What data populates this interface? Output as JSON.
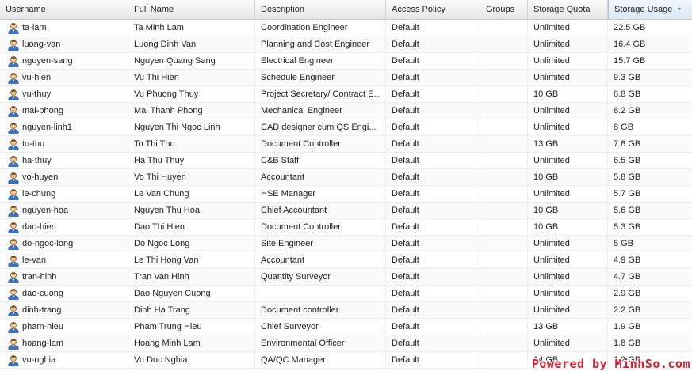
{
  "columns": {
    "username": "Username",
    "full_name": "Full Name",
    "description": "Description",
    "access_policy": "Access Policy",
    "groups": "Groups",
    "storage_quota": "Storage Quota",
    "storage_usage": "Storage Usage"
  },
  "sort": {
    "column": "storage_usage",
    "direction": "descending"
  },
  "rows": [
    {
      "username": "ta-lam",
      "full_name": "Ta Minh Lam",
      "description": "Coordination Engineer",
      "access_policy": "Default",
      "groups": "",
      "storage_quota": "Unlimited",
      "storage_usage": "22.5 GB"
    },
    {
      "username": "luong-van",
      "full_name": "Luong Dinh Van",
      "description": "Planning and Cost Engineer",
      "access_policy": "Default",
      "groups": "",
      "storage_quota": "Unlimited",
      "storage_usage": "16.4 GB"
    },
    {
      "username": "nguyen-sang",
      "full_name": "Nguyen Quang Sang",
      "description": "Electrical Engineer",
      "access_policy": "Default",
      "groups": "",
      "storage_quota": "Unlimited",
      "storage_usage": "15.7 GB"
    },
    {
      "username": "vu-hien",
      "full_name": "Vu Thi Hien",
      "description": "Schedule Engineer",
      "access_policy": "Default",
      "groups": "",
      "storage_quota": "Unlimited",
      "storage_usage": "9.3 GB"
    },
    {
      "username": "vu-thuy",
      "full_name": "Vu Phuong Thuy",
      "description": "Project Secretary/ Contract E...",
      "access_policy": "Default",
      "groups": "",
      "storage_quota": "10 GB",
      "storage_usage": "8.8 GB"
    },
    {
      "username": "mai-phong",
      "full_name": "Mai Thanh Phong",
      "description": "Mechanical Engineer",
      "access_policy": "Default",
      "groups": "",
      "storage_quota": "Unlimited",
      "storage_usage": "8.2 GB"
    },
    {
      "username": "nguyen-linh1",
      "full_name": "Nguyen Thi Ngoc Linh",
      "description": " CAD designer cum QS Engi...",
      "access_policy": "Default",
      "groups": "",
      "storage_quota": "Unlimited",
      "storage_usage": "8 GB"
    },
    {
      "username": "to-thu",
      "full_name": "To Thi Thu",
      "description": "Document Controller",
      "access_policy": "Default",
      "groups": "",
      "storage_quota": "13 GB",
      "storage_usage": "7.8 GB"
    },
    {
      "username": "ha-thuy",
      "full_name": "Ha Thu Thuy",
      "description": "C&B Staff",
      "access_policy": "Default",
      "groups": "",
      "storage_quota": "Unlimited",
      "storage_usage": "6.5 GB"
    },
    {
      "username": "vo-huyen",
      "full_name": "Vo Thi Huyen",
      "description": "Accountant",
      "access_policy": "Default",
      "groups": "",
      "storage_quota": "10 GB",
      "storage_usage": "5.8 GB"
    },
    {
      "username": "le-chung",
      "full_name": "Le Van Chung",
      "description": "HSE Manager",
      "access_policy": "Default",
      "groups": "",
      "storage_quota": "Unlimited",
      "storage_usage": "5.7 GB"
    },
    {
      "username": "nguyen-hoa",
      "full_name": "Nguyen Thu Hoa",
      "description": "Chief Accountant",
      "access_policy": "Default",
      "groups": "",
      "storage_quota": "10 GB",
      "storage_usage": "5.6 GB"
    },
    {
      "username": "dao-hien",
      "full_name": "Dao Thi Hien",
      "description": "Document Controller",
      "access_policy": "Default",
      "groups": "",
      "storage_quota": "10 GB",
      "storage_usage": "5.3 GB"
    },
    {
      "username": "do-ngoc-long",
      "full_name": "Do Ngoc Long",
      "description": "Site Engineer",
      "access_policy": "Default",
      "groups": "",
      "storage_quota": "Unlimited",
      "storage_usage": "5 GB"
    },
    {
      "username": "le-van",
      "full_name": "Le Thi Hong Van",
      "description": "Accountant",
      "access_policy": "Default",
      "groups": "",
      "storage_quota": "Unlimited",
      "storage_usage": "4.9 GB"
    },
    {
      "username": "tran-hinh",
      "full_name": "Tran Van Hinh",
      "description": "Quantity Surveyor",
      "access_policy": "Default",
      "groups": "",
      "storage_quota": "Unlimited",
      "storage_usage": "4.7 GB"
    },
    {
      "username": "dao-cuong",
      "full_name": "Dao Nguyen Cuong",
      "description": "",
      "access_policy": "Default",
      "groups": "",
      "storage_quota": "Unlimited",
      "storage_usage": "2.9 GB"
    },
    {
      "username": "dinh-trang",
      "full_name": "Dinh Ha Trang",
      "description": "Document controller",
      "access_policy": "Default",
      "groups": "",
      "storage_quota": "Unlimited",
      "storage_usage": "2.2 GB"
    },
    {
      "username": "pham-hieu",
      "full_name": "Pham Trung Hieu",
      "description": "Chief Surveyor",
      "access_policy": "Default",
      "groups": "",
      "storage_quota": "13 GB",
      "storage_usage": "1.9 GB"
    },
    {
      "username": "hoang-lam",
      "full_name": "Hoang Minh Lam",
      "description": "Environmental Officer",
      "access_policy": "Default",
      "groups": "",
      "storage_quota": "Unlimited",
      "storage_usage": "1.8 GB"
    },
    {
      "username": "vu-nghia",
      "full_name": "Vu Duc Nghia",
      "description": "QA/QC Manager",
      "access_policy": "Default",
      "groups": "",
      "storage_quota": "14 GB",
      "storage_usage": "1.2 GB"
    }
  ],
  "row_icon": "user-icon",
  "watermark": "Powered by MinhSo.com",
  "colors": {
    "watermark": "#d3202e",
    "sorted_header": "#dbe7f6",
    "sort_arrow": "#4a7cc4"
  }
}
